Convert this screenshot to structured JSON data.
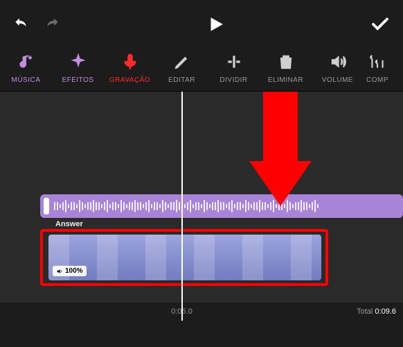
{
  "topbar": {},
  "toolbar": {
    "items": [
      {
        "label": "MÚSICA"
      },
      {
        "label": "EFEITOS"
      },
      {
        "label": "GRAVAÇÃO"
      },
      {
        "label": "EDITAR"
      },
      {
        "label": "DIVIDIR"
      },
      {
        "label": "ELIMINAR"
      },
      {
        "label": "VOLUME"
      },
      {
        "label": "COMP"
      }
    ]
  },
  "tracks": {
    "video_label": "Answer",
    "audio_volume": "100%"
  },
  "time": {
    "t1": "0:05.0",
    "total_label": "Total",
    "total_value": "0:09.6"
  }
}
